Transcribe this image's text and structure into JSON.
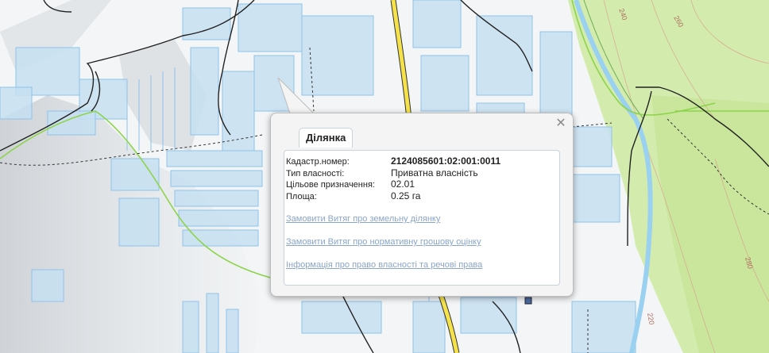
{
  "map": {
    "contour_labels": [
      "240",
      "260",
      "280",
      "220",
      "280"
    ],
    "colors": {
      "background_light": "#f3f5f6",
      "hillshade": "#c9ced3",
      "parcel_fill": "#c5dff1",
      "parcel_stroke": "#8ec3ec",
      "road_major": "#f5e24a",
      "road_outline": "#222222",
      "boundary_green": "#8cd44a",
      "forest": "#cfe9a8",
      "river": "#9ad0f0",
      "contour": "#d9a08a"
    }
  },
  "popup": {
    "tab_label": "Ділянка",
    "close_symbol": "✕",
    "fields": [
      {
        "label": "Кадастр.номер:",
        "value": "2124085601:02:001:0011"
      },
      {
        "label": "Тип власності:",
        "value": "Приватна власність"
      },
      {
        "label": "Цільове призначення:",
        "value": "02.01"
      },
      {
        "label": "Площа:",
        "value": "0.25 га"
      }
    ],
    "links": [
      "Замовити Витяг про земельну ділянку",
      "Замовити Витяг про нормативну грошову оцінку",
      "Інформація про право власності та речові права"
    ]
  }
}
